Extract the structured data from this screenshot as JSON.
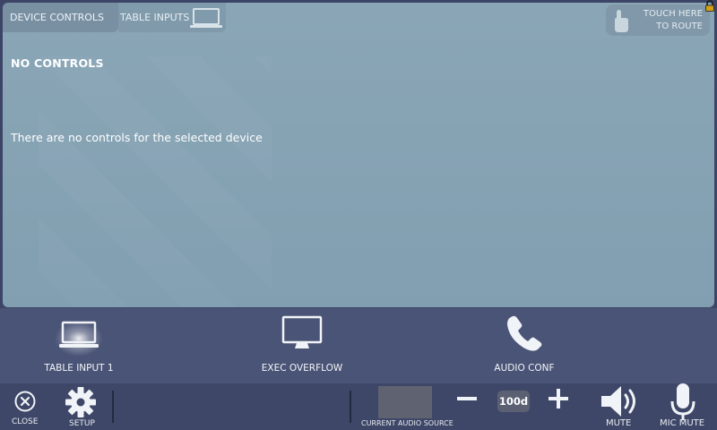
{
  "tabs": {
    "device_controls": "DEVICE CONTROLS",
    "table_inputs": "TABLE INPUTS"
  },
  "touch_route": {
    "line1": "TOUCH HERE",
    "line2": "TO ROUTE"
  },
  "main": {
    "title": "NO CONTROLS",
    "message": "There are no controls for the selected device"
  },
  "sources": [
    {
      "label": "TABLE INPUT 1",
      "icon": "laptop-icon",
      "active": true
    },
    {
      "label": "EXEC OVERFLOW",
      "icon": "monitor-icon",
      "active": false
    },
    {
      "label": "AUDIO CONF",
      "icon": "phone-icon",
      "active": false
    }
  ],
  "bottom_bar": {
    "close_label": "CLOSE",
    "setup_label": "SETUP",
    "audio_source_label": "CURRENT AUDIO SOURCE",
    "volume": "100d",
    "mute_label": "MUTE",
    "mic_mute_label": "MIC MUTE"
  },
  "colors": {
    "panel": "#85a2b3",
    "strip": "#4a5476",
    "bar": "#3e4767"
  }
}
